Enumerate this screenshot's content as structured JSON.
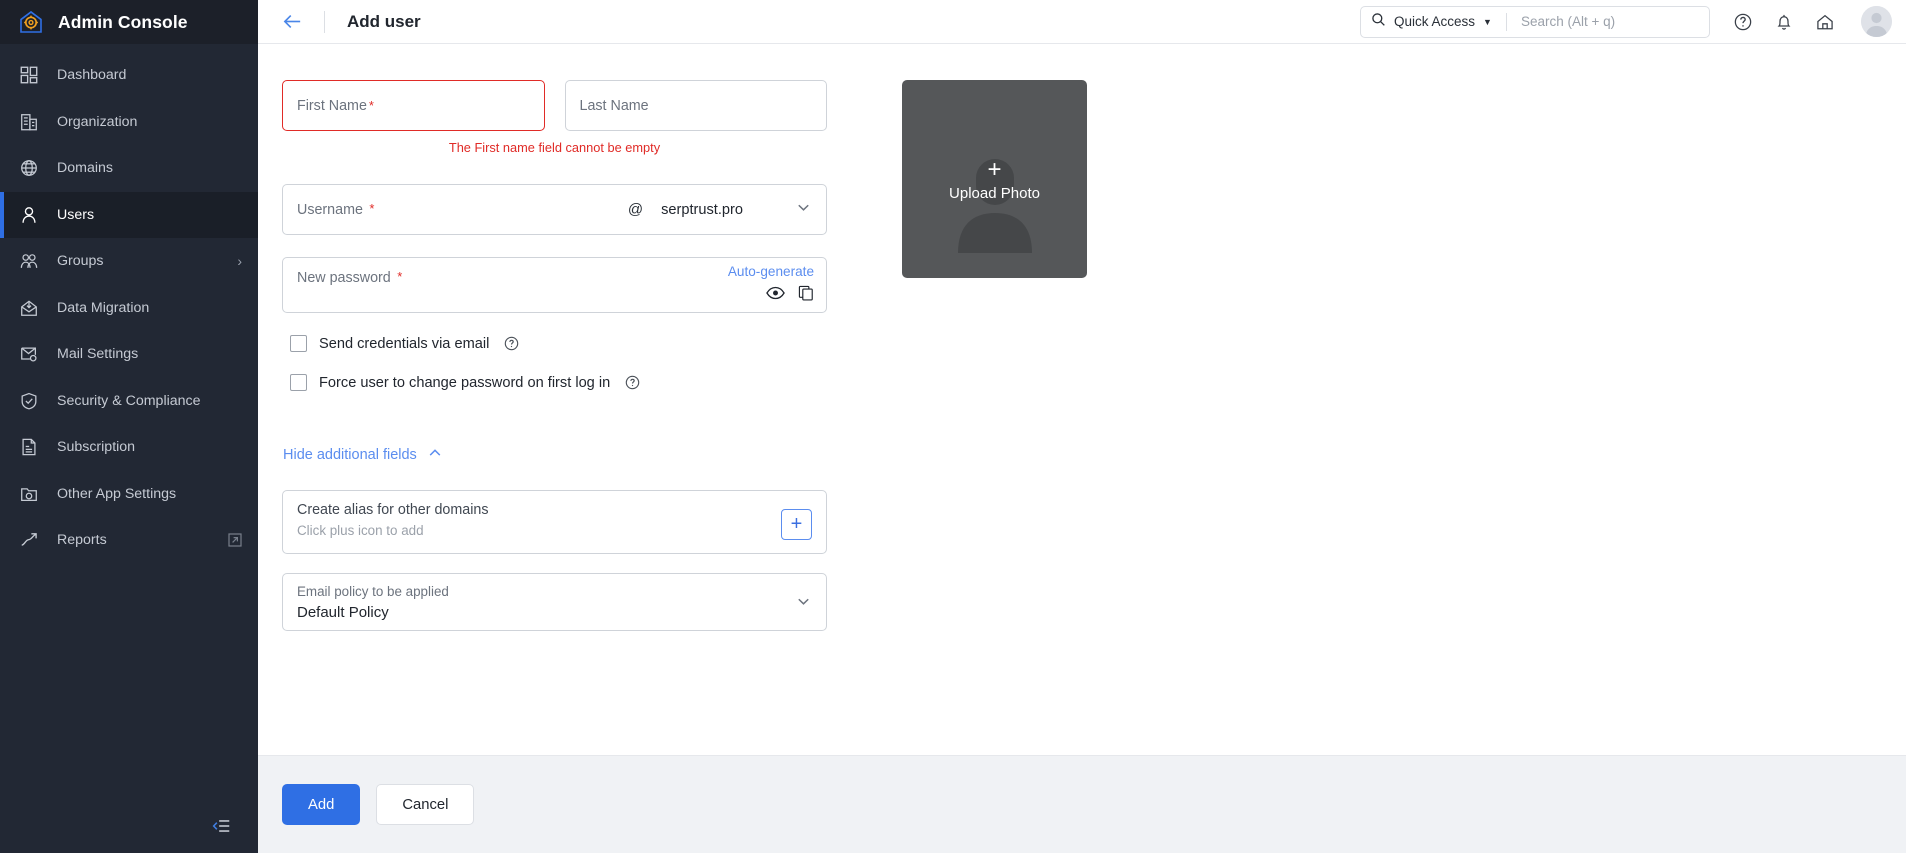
{
  "brand": {
    "title": "Admin Console",
    "logo_icon": "admin-house-gear-logo"
  },
  "sidebar": {
    "items": [
      {
        "label": "Dashboard",
        "icon": "dashboard-grid-icon",
        "active": false
      },
      {
        "label": "Organization",
        "icon": "building-icon",
        "active": false
      },
      {
        "label": "Domains",
        "icon": "globe-icon",
        "active": false
      },
      {
        "label": "Users",
        "icon": "user-icon",
        "active": true
      },
      {
        "label": "Groups",
        "icon": "users-group-icon",
        "active": false,
        "chevron": "›"
      },
      {
        "label": "Data Migration",
        "icon": "mail-download-icon",
        "active": false
      },
      {
        "label": "Mail Settings",
        "icon": "mail-gear-icon",
        "active": false
      },
      {
        "label": "Security & Compliance",
        "icon": "shield-check-icon",
        "active": false
      },
      {
        "label": "Subscription",
        "icon": "invoice-icon",
        "active": false
      },
      {
        "label": "Other App Settings",
        "icon": "folder-gear-icon",
        "active": false
      },
      {
        "label": "Reports",
        "icon": "trend-up-icon",
        "active": false,
        "external": true
      }
    ],
    "collapse_icon": "collapse-sidebar-icon"
  },
  "topbar": {
    "back_icon": "back-arrow-icon",
    "title": "Add user",
    "quick_access_label": "Quick Access",
    "quick_access_caret": "▼",
    "search_icon": "search-icon",
    "search_placeholder": "Search (Alt + q)",
    "search_value": "",
    "icons": [
      {
        "name": "help-icon"
      },
      {
        "name": "notification-bell-icon"
      },
      {
        "name": "home-icon"
      }
    ],
    "avatar": "user-avatar"
  },
  "form": {
    "first_name": {
      "placeholder": "First Name",
      "value": "",
      "required_marker": "*",
      "error": "The First name field cannot be empty"
    },
    "last_name": {
      "placeholder": "Last Name",
      "value": ""
    },
    "username": {
      "placeholder": "Username",
      "value": "",
      "required_marker": "*",
      "at_symbol": "@",
      "domain_value": "serptrust.pro",
      "domain_caret_icon": "chevron-down-icon"
    },
    "password": {
      "placeholder": "New password",
      "value": "",
      "required_marker": "*",
      "autogenerate_label": "Auto-generate",
      "show_icon": "eye-icon",
      "copy_icon": "copy-icon"
    },
    "checkboxes": [
      {
        "label": "Send credentials via email",
        "checked": false,
        "help_icon": "help-circle-icon"
      },
      {
        "label": "Force user to change password on first log in",
        "checked": false,
        "help_icon": "help-circle-icon"
      }
    ],
    "toggle_additional": {
      "label": "Hide additional fields",
      "icon": "chevron-up-icon"
    },
    "alias": {
      "title": "Create alias for other domains",
      "hint": "Click plus icon to add",
      "add_icon": "plus-icon",
      "add_symbol": "+"
    },
    "policy": {
      "label": "Email policy to be applied",
      "value": "Default Policy",
      "caret_icon": "chevron-down-icon"
    }
  },
  "photo": {
    "label": "Upload Photo",
    "plus_symbol": "+",
    "icon": "avatar-silhouette-icon"
  },
  "footer": {
    "primary_label": "Add",
    "secondary_label": "Cancel"
  },
  "colors": {
    "accent": "#2f6fe4",
    "link": "#5b8def",
    "error": "#e02b27",
    "sidebar_bg": "#222834",
    "footer_bg": "#f0f2f5",
    "photo_bg": "#555759"
  }
}
